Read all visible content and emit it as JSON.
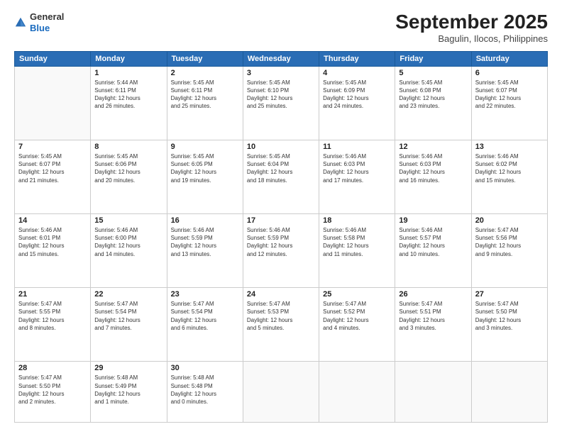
{
  "header": {
    "logo": {
      "line1": "General",
      "line2": "Blue"
    },
    "title": "September 2025",
    "location": "Bagulin, Ilocos, Philippines"
  },
  "days_of_week": [
    "Sunday",
    "Monday",
    "Tuesday",
    "Wednesday",
    "Thursday",
    "Friday",
    "Saturday"
  ],
  "weeks": [
    [
      {
        "day": "",
        "empty": true
      },
      {
        "day": "1",
        "sunrise": "5:44 AM",
        "sunset": "6:11 PM",
        "daylight": "12 hours and 26 minutes."
      },
      {
        "day": "2",
        "sunrise": "5:45 AM",
        "sunset": "6:11 PM",
        "daylight": "12 hours and 25 minutes."
      },
      {
        "day": "3",
        "sunrise": "5:45 AM",
        "sunset": "6:10 PM",
        "daylight": "12 hours and 25 minutes."
      },
      {
        "day": "4",
        "sunrise": "5:45 AM",
        "sunset": "6:09 PM",
        "daylight": "12 hours and 24 minutes."
      },
      {
        "day": "5",
        "sunrise": "5:45 AM",
        "sunset": "6:08 PM",
        "daylight": "12 hours and 23 minutes."
      },
      {
        "day": "6",
        "sunrise": "5:45 AM",
        "sunset": "6:07 PM",
        "daylight": "12 hours and 22 minutes."
      }
    ],
    [
      {
        "day": "7",
        "sunrise": "5:45 AM",
        "sunset": "6:07 PM",
        "daylight": "12 hours and 21 minutes."
      },
      {
        "day": "8",
        "sunrise": "5:45 AM",
        "sunset": "6:06 PM",
        "daylight": "12 hours and 20 minutes."
      },
      {
        "day": "9",
        "sunrise": "5:45 AM",
        "sunset": "6:05 PM",
        "daylight": "12 hours and 19 minutes."
      },
      {
        "day": "10",
        "sunrise": "5:45 AM",
        "sunset": "6:04 PM",
        "daylight": "12 hours and 18 minutes."
      },
      {
        "day": "11",
        "sunrise": "5:46 AM",
        "sunset": "6:03 PM",
        "daylight": "12 hours and 17 minutes."
      },
      {
        "day": "12",
        "sunrise": "5:46 AM",
        "sunset": "6:03 PM",
        "daylight": "12 hours and 16 minutes."
      },
      {
        "day": "13",
        "sunrise": "5:46 AM",
        "sunset": "6:02 PM",
        "daylight": "12 hours and 15 minutes."
      }
    ],
    [
      {
        "day": "14",
        "sunrise": "5:46 AM",
        "sunset": "6:01 PM",
        "daylight": "12 hours and 15 minutes."
      },
      {
        "day": "15",
        "sunrise": "5:46 AM",
        "sunset": "6:00 PM",
        "daylight": "12 hours and 14 minutes."
      },
      {
        "day": "16",
        "sunrise": "5:46 AM",
        "sunset": "5:59 PM",
        "daylight": "12 hours and 13 minutes."
      },
      {
        "day": "17",
        "sunrise": "5:46 AM",
        "sunset": "5:59 PM",
        "daylight": "12 hours and 12 minutes."
      },
      {
        "day": "18",
        "sunrise": "5:46 AM",
        "sunset": "5:58 PM",
        "daylight": "12 hours and 11 minutes."
      },
      {
        "day": "19",
        "sunrise": "5:46 AM",
        "sunset": "5:57 PM",
        "daylight": "12 hours and 10 minutes."
      },
      {
        "day": "20",
        "sunrise": "5:47 AM",
        "sunset": "5:56 PM",
        "daylight": "12 hours and 9 minutes."
      }
    ],
    [
      {
        "day": "21",
        "sunrise": "5:47 AM",
        "sunset": "5:55 PM",
        "daylight": "12 hours and 8 minutes."
      },
      {
        "day": "22",
        "sunrise": "5:47 AM",
        "sunset": "5:54 PM",
        "daylight": "12 hours and 7 minutes."
      },
      {
        "day": "23",
        "sunrise": "5:47 AM",
        "sunset": "5:54 PM",
        "daylight": "12 hours and 6 minutes."
      },
      {
        "day": "24",
        "sunrise": "5:47 AM",
        "sunset": "5:53 PM",
        "daylight": "12 hours and 5 minutes."
      },
      {
        "day": "25",
        "sunrise": "5:47 AM",
        "sunset": "5:52 PM",
        "daylight": "12 hours and 4 minutes."
      },
      {
        "day": "26",
        "sunrise": "5:47 AM",
        "sunset": "5:51 PM",
        "daylight": "12 hours and 3 minutes."
      },
      {
        "day": "27",
        "sunrise": "5:47 AM",
        "sunset": "5:50 PM",
        "daylight": "12 hours and 3 minutes."
      }
    ],
    [
      {
        "day": "28",
        "sunrise": "5:47 AM",
        "sunset": "5:50 PM",
        "daylight": "12 hours and 2 minutes."
      },
      {
        "day": "29",
        "sunrise": "5:48 AM",
        "sunset": "5:49 PM",
        "daylight": "12 hours and 1 minute."
      },
      {
        "day": "30",
        "sunrise": "5:48 AM",
        "sunset": "5:48 PM",
        "daylight": "12 hours and 0 minutes."
      },
      {
        "day": "",
        "empty": true
      },
      {
        "day": "",
        "empty": true
      },
      {
        "day": "",
        "empty": true
      },
      {
        "day": "",
        "empty": true
      }
    ]
  ],
  "labels": {
    "sunrise": "Sunrise:",
    "sunset": "Sunset:",
    "daylight": "Daylight:"
  }
}
